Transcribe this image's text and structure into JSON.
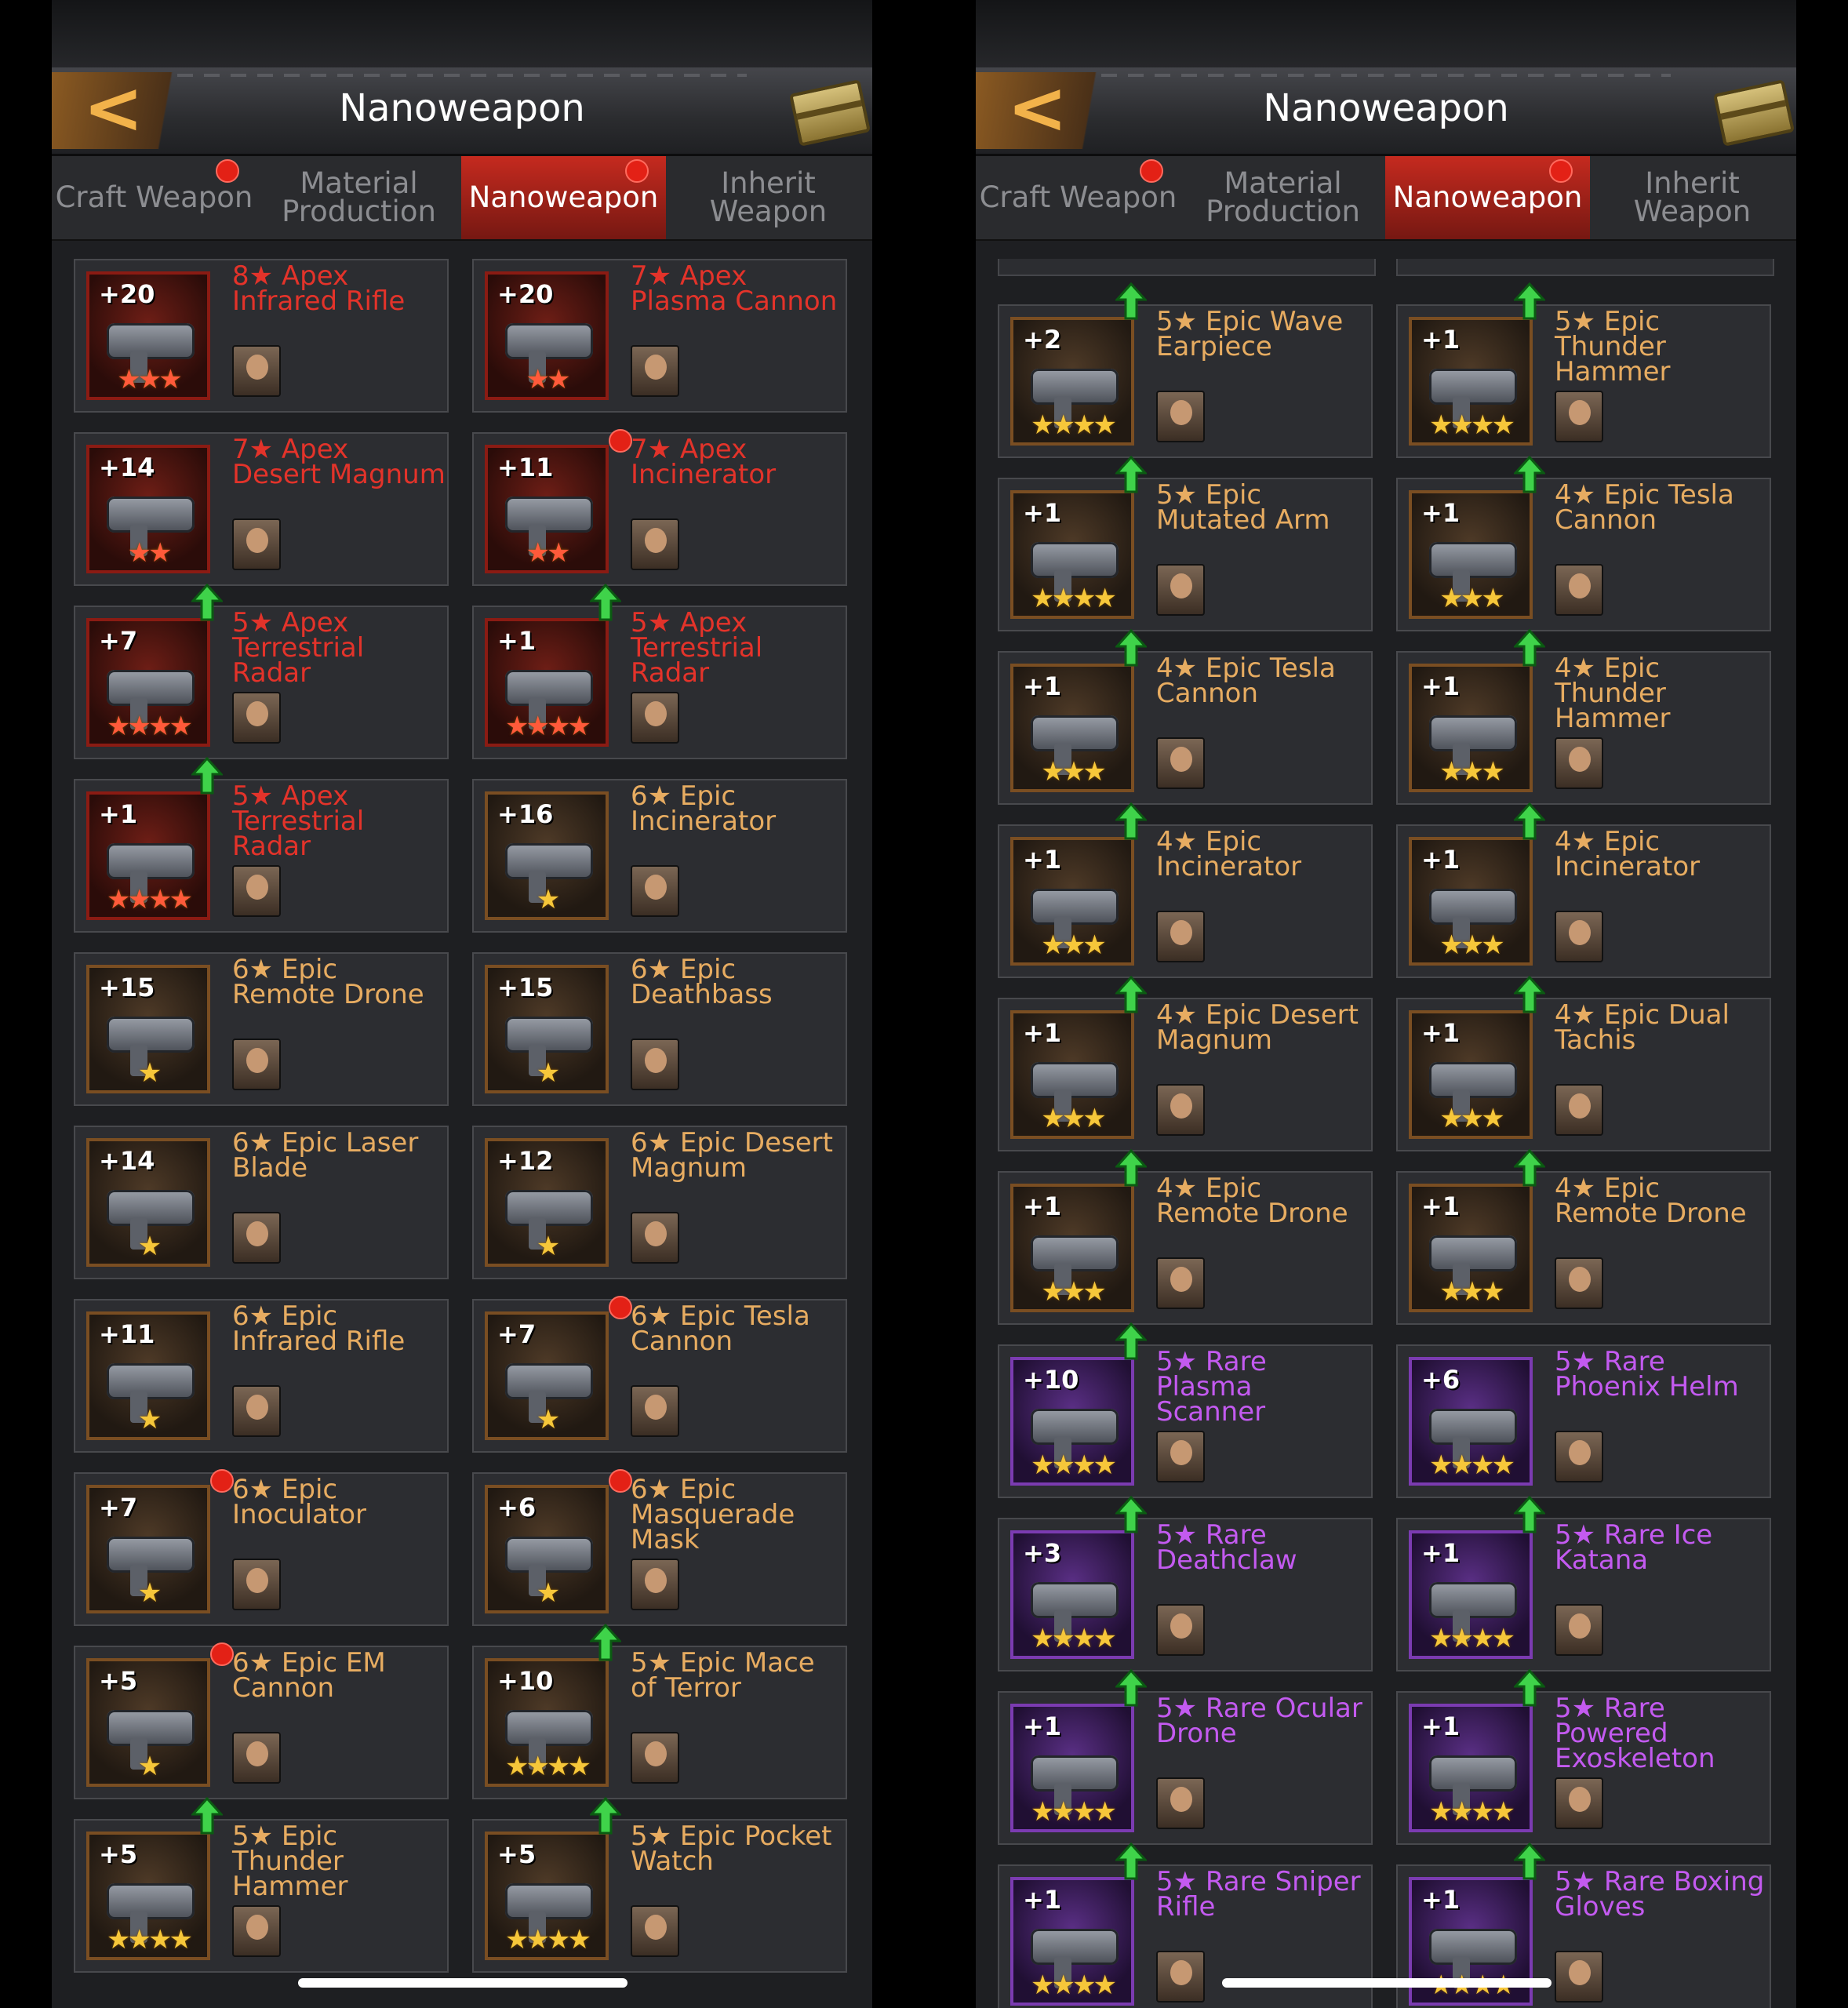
{
  "panels": [
    {
      "title": "Nanoweapon",
      "tabs": [
        {
          "label": "Craft Weapon",
          "active": false,
          "badge": true
        },
        {
          "label": "Material Production",
          "active": false,
          "badge": false
        },
        {
          "label": "Nanoweapon",
          "active": true,
          "badge": true
        },
        {
          "label": "Inherit Weapon",
          "active": false,
          "badge": false
        }
      ],
      "cards": [
        {
          "plus": "+20",
          "name": "8★ Apex Infrared Rifle",
          "stars": "★★★",
          "tier": "apex",
          "upgrade": false,
          "badge": false
        },
        {
          "plus": "+20",
          "name": "7★ Apex Plasma Cannon",
          "stars": "★★",
          "tier": "apex",
          "upgrade": false,
          "badge": false
        },
        {
          "plus": "+14",
          "name": "7★ Apex Desert Magnum",
          "stars": "★★",
          "tier": "apex",
          "upgrade": false,
          "badge": false
        },
        {
          "plus": "+11",
          "name": "7★ Apex Incinerator",
          "stars": "★★",
          "tier": "apex",
          "upgrade": false,
          "badge": true
        },
        {
          "plus": "+7",
          "name": "5★ Apex Terrestrial Radar",
          "stars": "★★★★",
          "tier": "apex",
          "upgrade": true,
          "badge": false
        },
        {
          "plus": "+1",
          "name": "5★ Apex Terrestrial Radar",
          "stars": "★★★★",
          "tier": "apex",
          "upgrade": true,
          "badge": false
        },
        {
          "plus": "+1",
          "name": "5★ Apex Terrestrial Radar",
          "stars": "★★★★",
          "tier": "apex",
          "upgrade": true,
          "badge": false
        },
        {
          "plus": "+16",
          "name": "6★ Epic Incinerator",
          "stars": "★",
          "tier": "epic",
          "upgrade": false,
          "badge": false
        },
        {
          "plus": "+15",
          "name": "6★ Epic Remote Drone",
          "stars": "★",
          "tier": "epic",
          "upgrade": false,
          "badge": false
        },
        {
          "plus": "+15",
          "name": "6★ Epic Deathbass",
          "stars": "★",
          "tier": "epic",
          "upgrade": false,
          "badge": false
        },
        {
          "plus": "+14",
          "name": "6★ Epic Laser Blade",
          "stars": "★",
          "tier": "epic",
          "upgrade": false,
          "badge": false
        },
        {
          "plus": "+12",
          "name": "6★ Epic Desert Magnum",
          "stars": "★",
          "tier": "epic",
          "upgrade": false,
          "badge": false
        },
        {
          "plus": "+11",
          "name": "6★ Epic Infrared Rifle",
          "stars": "★",
          "tier": "epic",
          "upgrade": false,
          "badge": false
        },
        {
          "plus": "+7",
          "name": "6★ Epic Tesla Cannon",
          "stars": "★",
          "tier": "epic",
          "upgrade": false,
          "badge": true
        },
        {
          "plus": "+7",
          "name": "6★ Epic Inoculator",
          "stars": "★",
          "tier": "epic",
          "upgrade": false,
          "badge": true
        },
        {
          "plus": "+6",
          "name": "6★ Epic Masquerade Mask",
          "stars": "★",
          "tier": "epic",
          "upgrade": false,
          "badge": true
        },
        {
          "plus": "+5",
          "name": "6★ Epic EM Cannon",
          "stars": "★",
          "tier": "epic",
          "upgrade": false,
          "badge": true
        },
        {
          "plus": "+10",
          "name": "5★ Epic Mace of Terror",
          "stars": "★★★★",
          "tier": "epic",
          "upgrade": true,
          "badge": false
        },
        {
          "plus": "+5",
          "name": "5★ Epic Thunder Hammer",
          "stars": "★★★★",
          "tier": "epic",
          "upgrade": true,
          "badge": false
        },
        {
          "plus": "+5",
          "name": "5★ Epic Pocket Watch",
          "stars": "★★★★",
          "tier": "epic",
          "upgrade": true,
          "badge": false
        }
      ]
    },
    {
      "title": "Nanoweapon",
      "tabs": [
        {
          "label": "Craft Weapon",
          "active": false,
          "badge": true
        },
        {
          "label": "Material Production",
          "active": false,
          "badge": false
        },
        {
          "label": "Nanoweapon",
          "active": true,
          "badge": true
        },
        {
          "label": "Inherit Weapon",
          "active": false,
          "badge": false
        }
      ],
      "cards": [
        {
          "plus": "+2",
          "name": "5★ Epic Wave Earpiece",
          "stars": "★★★★",
          "tier": "epic",
          "upgrade": true,
          "badge": false
        },
        {
          "plus": "+1",
          "name": "5★ Epic Thunder Hammer",
          "stars": "★★★★",
          "tier": "epic",
          "upgrade": true,
          "badge": false
        },
        {
          "plus": "+1",
          "name": "5★ Epic Mutated Arm",
          "stars": "★★★★",
          "tier": "epic",
          "upgrade": true,
          "badge": false
        },
        {
          "plus": "+1",
          "name": "4★ Epic Tesla Cannon",
          "stars": "★★★",
          "tier": "epic",
          "upgrade": true,
          "badge": false
        },
        {
          "plus": "+1",
          "name": "4★ Epic Tesla Cannon",
          "stars": "★★★",
          "tier": "epic",
          "upgrade": true,
          "badge": false
        },
        {
          "plus": "+1",
          "name": "4★ Epic Thunder Hammer",
          "stars": "★★★",
          "tier": "epic",
          "upgrade": true,
          "badge": false
        },
        {
          "plus": "+1",
          "name": "4★ Epic Incinerator",
          "stars": "★★★",
          "tier": "epic",
          "upgrade": true,
          "badge": false
        },
        {
          "plus": "+1",
          "name": "4★ Epic Incinerator",
          "stars": "★★★",
          "tier": "epic",
          "upgrade": true,
          "badge": false
        },
        {
          "plus": "+1",
          "name": "4★ Epic Desert Magnum",
          "stars": "★★★",
          "tier": "epic",
          "upgrade": true,
          "badge": false
        },
        {
          "plus": "+1",
          "name": "4★ Epic Dual Tachis",
          "stars": "★★★",
          "tier": "epic",
          "upgrade": true,
          "badge": false
        },
        {
          "plus": "+1",
          "name": "4★ Epic Remote Drone",
          "stars": "★★★",
          "tier": "epic",
          "upgrade": true,
          "badge": false
        },
        {
          "plus": "+1",
          "name": "4★ Epic Remote Drone",
          "stars": "★★★",
          "tier": "epic",
          "upgrade": true,
          "badge": false
        },
        {
          "plus": "+10",
          "name": "5★ Rare Plasma Scanner",
          "stars": "★★★★",
          "tier": "rare",
          "upgrade": true,
          "badge": false
        },
        {
          "plus": "+6",
          "name": "5★ Rare Phoenix Helm",
          "stars": "★★★★",
          "tier": "rare",
          "upgrade": false,
          "badge": false
        },
        {
          "plus": "+3",
          "name": "5★ Rare Deathclaw",
          "stars": "★★★★",
          "tier": "rare",
          "upgrade": true,
          "badge": false
        },
        {
          "plus": "+1",
          "name": "5★ Rare Ice Katana",
          "stars": "★★★★",
          "tier": "rare",
          "upgrade": true,
          "badge": false
        },
        {
          "plus": "+1",
          "name": "5★ Rare Ocular Drone",
          "stars": "★★★★",
          "tier": "rare",
          "upgrade": true,
          "badge": false
        },
        {
          "plus": "+1",
          "name": "5★ Rare Powered Exoskeleton",
          "stars": "★★★★",
          "tier": "rare",
          "upgrade": true,
          "badge": false
        },
        {
          "plus": "+1",
          "name": "5★ Rare Sniper Rifle",
          "stars": "★★★★",
          "tier": "rare",
          "upgrade": true,
          "badge": false
        },
        {
          "plus": "+1",
          "name": "5★ Rare Boxing Gloves",
          "stars": "★★★★",
          "tier": "rare",
          "upgrade": true,
          "badge": false
        }
      ]
    }
  ],
  "icons": {
    "back": "back-arrow-icon",
    "chest": "chest-icon",
    "upgrade": "green-up-arrow-icon"
  }
}
